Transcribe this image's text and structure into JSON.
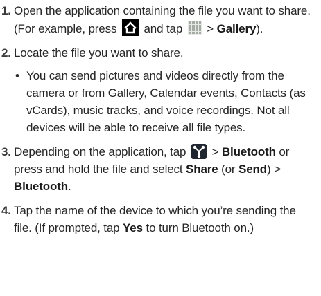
{
  "steps": [
    {
      "num": "1.",
      "p1": "Open the application containing the file you want to share. (For example, press",
      "p2": "and tap",
      "p3": ">",
      "gallery": "Gallery",
      "p4": ")."
    },
    {
      "num": "2.",
      "text": "Locate the file you want to share.",
      "bullet": "You can send pictures and videos directly from the camera or from Gallery, Calendar events, Contacts (as vCards), music tracks, and voice recordings. Not all devices will be able to receive all file types."
    },
    {
      "num": "3.",
      "p1": "Depending on the application, tap",
      "p2": ">",
      "bt1": "Bluetooth",
      "p3": "or press and hold the file and select",
      "share": "Share",
      "p4": "(or",
      "send": "Send",
      "p5": ") >",
      "bt2": "Bluetooth",
      "p6": "."
    },
    {
      "num": "4.",
      "p1": "Tap the name of the device to which you’re sending the file. (If prompted, tap",
      "yes": "Yes",
      "p2": "to turn Bluetooth on.)"
    }
  ],
  "icons": [
    "home-icon",
    "apps-grid-icon",
    "share-icon"
  ],
  "colors": {
    "text": "#262626",
    "icon_dark": "#000000",
    "grid": "#9aa19a"
  }
}
